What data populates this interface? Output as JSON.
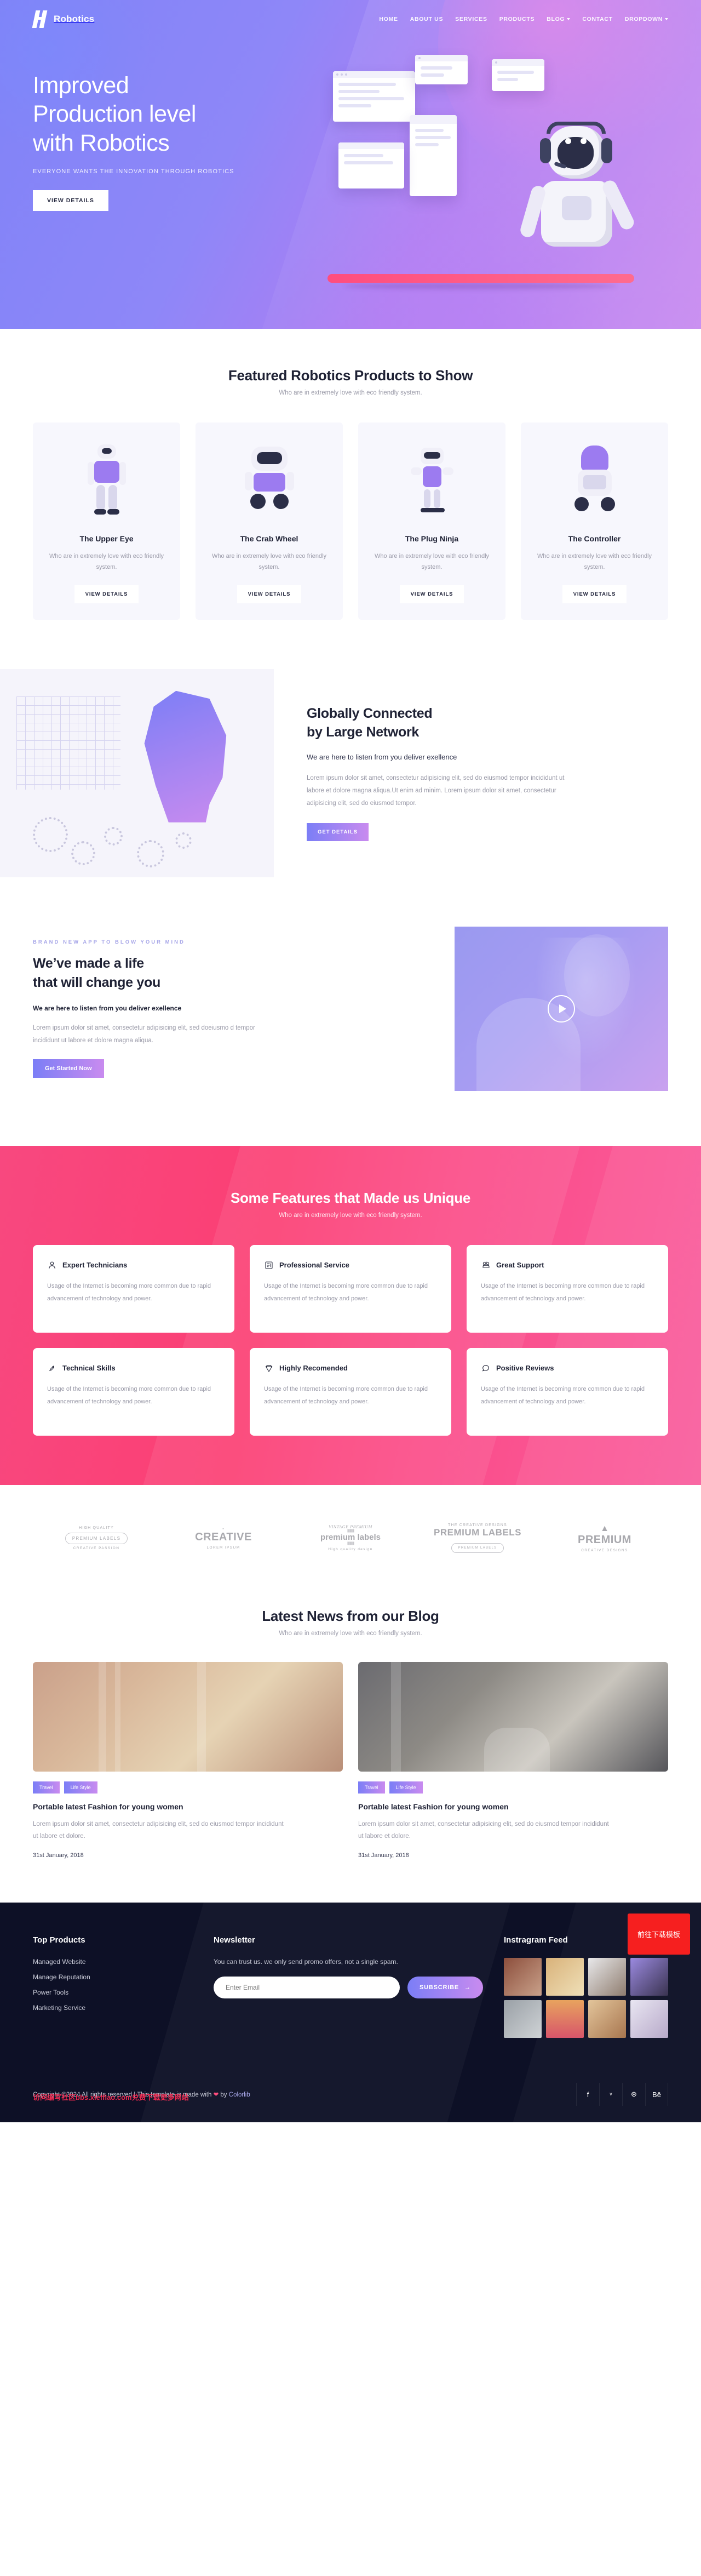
{
  "header": {
    "brand": "Robotics",
    "nav": [
      {
        "label": "HOME",
        "caret": false
      },
      {
        "label": "ABOUT US",
        "caret": false
      },
      {
        "label": "SERVICES",
        "caret": false
      },
      {
        "label": "PRODUCTS",
        "caret": false
      },
      {
        "label": "BLOG",
        "caret": true
      },
      {
        "label": "CONTACT",
        "caret": false
      },
      {
        "label": "DROPDOWN",
        "caret": true
      }
    ]
  },
  "hero": {
    "title_line1": "Improved",
    "title_line2": "Production level",
    "title_line3": "with Robotics",
    "subtitle": "EVERYONE WANTS THE INNOVATION THROUGH ROBOTICS",
    "cta": "VIEW DETAILS"
  },
  "products": {
    "title": "Featured Robotics Products to Show",
    "subtitle": "Who are in extremely love with eco friendly system.",
    "cards": [
      {
        "name": "The Upper Eye",
        "desc": "Who are in extremely love with eco friendly system.",
        "cta": "VIEW DETAILS"
      },
      {
        "name": "The Crab Wheel",
        "desc": "Who are in extremely love with eco friendly system.",
        "cta": "VIEW DETAILS"
      },
      {
        "name": "The Plug Ninja",
        "desc": "Who are in extremely love with eco friendly system.",
        "cta": "VIEW DETAILS"
      },
      {
        "name": "The Controller",
        "desc": "Who are in extremely love with eco friendly system.",
        "cta": "VIEW DETAILS"
      }
    ]
  },
  "connected": {
    "title_line1": "Globally Connected",
    "title_line2": "by Large Network",
    "lead": "We are here to listen from you deliver exellence",
    "body": "Lorem ipsum dolor sit amet, consectetur adipisicing elit, sed do eiusmod tempor incididunt ut labore et dolore magna aliqua.Ut enim ad minim. Lorem ipsum dolor sit amet, consectetur adipisicing elit, sed do eiusmod tempor.",
    "cta": "GET DETAILS"
  },
  "change": {
    "eyebrow": "BRAND NEW APP TO BLOW YOUR MIND",
    "title_line1": "We’ve made a life",
    "title_line2": "that will change you",
    "lead": "We are here to listen from you deliver exellence",
    "body": "Lorem ipsum dolor sit amet, consectetur adipisicing elit, sed doeiusmo d tempor incididunt ut labore et dolore magna aliqua.",
    "cta": "Get Started Now",
    "play_label": "play-video"
  },
  "features": {
    "title": "Some Features that Made us Unique",
    "subtitle": "Who are in extremely love with eco friendly system.",
    "cards": [
      {
        "icon": "user-icon",
        "glyph": "○",
        "title": "Expert Technicians",
        "desc": "Usage of the Internet is becoming more common due to rapid advancement of technology and power."
      },
      {
        "icon": "document-icon",
        "glyph": "▤",
        "title": "Professional Service",
        "desc": "Usage of the Internet is becoming more common due to rapid advancement of technology and power."
      },
      {
        "icon": "telephone-icon",
        "glyph": "☎",
        "title": "Great Support",
        "desc": "Usage of the Internet is becoming more common due to rapid advancement of technology and power."
      },
      {
        "icon": "rocket-icon",
        "glyph": "↗",
        "title": "Technical Skills",
        "desc": "Usage of the Internet is becoming more common due to rapid advancement of technology and power."
      },
      {
        "icon": "diamond-icon",
        "glyph": "◇",
        "title": "Highly Recomended",
        "desc": "Usage of the Internet is becoming more common due to rapid advancement of technology and power."
      },
      {
        "icon": "chat-bubble-icon",
        "glyph": "◯",
        "title": "Positive Reviews",
        "desc": "Usage of the Internet is becoming more common due to rapid advancement of technology and power."
      }
    ]
  },
  "brands": [
    {
      "top": "HIGH QUALITY",
      "main": "PREMIUM LABELS",
      "bottom": "CREATIVE PASSION"
    },
    {
      "top": "⋆",
      "main": "CREATIVE",
      "bottom": "LOREM IPSUM"
    },
    {
      "top": "VINTAGE PREMIUM",
      "main": "premium labels",
      "bottom": "High quality design"
    },
    {
      "top": "THE CREATIVE DESIGNS",
      "main": "PREMIUM LABELS",
      "bottom": "PREMIUM LABELS"
    },
    {
      "top": "▲",
      "main": "PREMIUM",
      "bottom": "CREATIVE DESIGNS"
    }
  ],
  "blog": {
    "title": "Latest News from our Blog",
    "subtitle": "Who are in extremely love with eco friendly system.",
    "posts": [
      {
        "tags": [
          "Travel",
          "Life Style"
        ],
        "title": "Portable latest Fashion for young women",
        "excerpt": "Lorem ipsum dolor sit amet, consectetur adipisicing elit, sed do eiusmod tempor incididunt ut labore et dolore.",
        "date": "31st January, 2018"
      },
      {
        "tags": [
          "Travel",
          "Life Style"
        ],
        "title": "Portable latest Fashion for young women",
        "excerpt": "Lorem ipsum dolor sit amet, consectetur adipisicing elit, sed do eiusmod tempor incididunt ut labore et dolore.",
        "date": "31st January, 2018"
      }
    ]
  },
  "footer": {
    "products_title": "Top Products",
    "products_links": [
      "Managed Website",
      "Manage Reputation",
      "Power Tools",
      "Marketing Service"
    ],
    "newsletter_title": "Newsletter",
    "newsletter_note": "You can trust us. we only send promo offers, not a single spam.",
    "email_placeholder": "Enter Email",
    "email_value": "",
    "subscribe_label": "SUBSCRIBE",
    "instagram_title": "Instragram Feed",
    "copyright_pre": "Copyright ©2024 All rights reserved | This template is made with ",
    "copyright_post": " by ",
    "copyright_author": "Colorlib",
    "watermark": "访问编写社区bbs.xlefflao.com兑费下载更多网站",
    "download_badge": "前往下载模板",
    "socials": [
      {
        "name": "facebook-icon",
        "glyph": "f"
      },
      {
        "name": "twitter-icon",
        "glyph": "ᵛ"
      },
      {
        "name": "dribbble-icon",
        "glyph": "⊛"
      },
      {
        "name": "behance-icon",
        "glyph": "Bē"
      }
    ]
  },
  "colors": {
    "purple": "#7b7ef6",
    "violet": "#c98bef",
    "pink": "#fb3f74",
    "dark": "#0d1026",
    "muted": "#9a9aa8"
  }
}
